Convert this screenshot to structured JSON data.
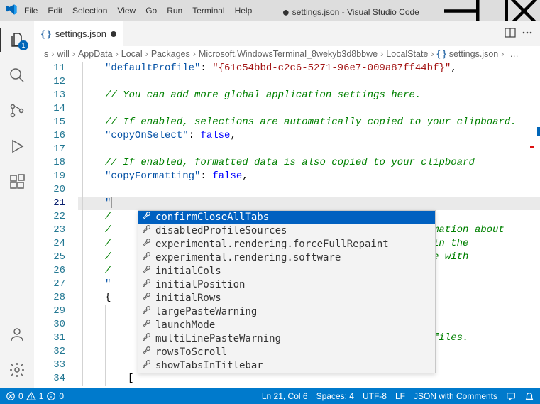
{
  "window": {
    "title_prefix": "●",
    "title": "settings.json - Visual Studio Code"
  },
  "menu": [
    "File",
    "Edit",
    "Selection",
    "View",
    "Go",
    "Run",
    "Terminal",
    "Help"
  ],
  "activity": {
    "explorer_badge": "1"
  },
  "tab": {
    "label": "settings.json"
  },
  "breadcrumbs": {
    "s": "s",
    "parts": [
      "will",
      "AppData",
      "Local",
      "Packages",
      "Microsoft.WindowsTerminal_8wekyb3d8bbwe",
      "LocalState"
    ],
    "file": "settings.json",
    "more": "…"
  },
  "gutter": {
    "start": 11,
    "end": 34,
    "current": 21
  },
  "code": {
    "l11_key": "\"defaultProfile\"",
    "l11_val": "\"{61c54bbd-c2c6-5271-96e7-009a87ff44bf}\"",
    "l13": "// You can add more global application settings here.",
    "l15": "// If enabled, selections are automatically copied to your clipboard.",
    "l16_key": "\"copyOnSelect\"",
    "l16_val": "false",
    "l18": "// If enabled, formatted data is also copied to your clipboard",
    "l19_key": "\"copyFormatting\"",
    "l19_val": "false",
    "l21_quote": "\"",
    "l22_c": "/",
    "l23_c": "/",
    "l23_tail": "nformation about",
    "l24_c": "/",
    "l24_tail": "ear in the",
    "l25_c": "/",
    "l25_tail": "dline with",
    "l26_c": "/",
    "l27_c": "\"",
    "l28_c": "{",
    "l31_tail": "l profiles.",
    "l34": "["
  },
  "suggest": [
    "confirmCloseAllTabs",
    "disabledProfileSources",
    "experimental.rendering.forceFullRepaint",
    "experimental.rendering.software",
    "initialCols",
    "initialPosition",
    "initialRows",
    "largePasteWarning",
    "launchMode",
    "multiLinePasteWarning",
    "rowsToScroll",
    "showTabsInTitlebar"
  ],
  "status": {
    "errors": "0",
    "warnings": "1",
    "info": "0",
    "pos": "Ln 21, Col 6",
    "spaces": "Spaces: 4",
    "encoding": "UTF-8",
    "eol": "LF",
    "lang": "JSON with Comments"
  }
}
